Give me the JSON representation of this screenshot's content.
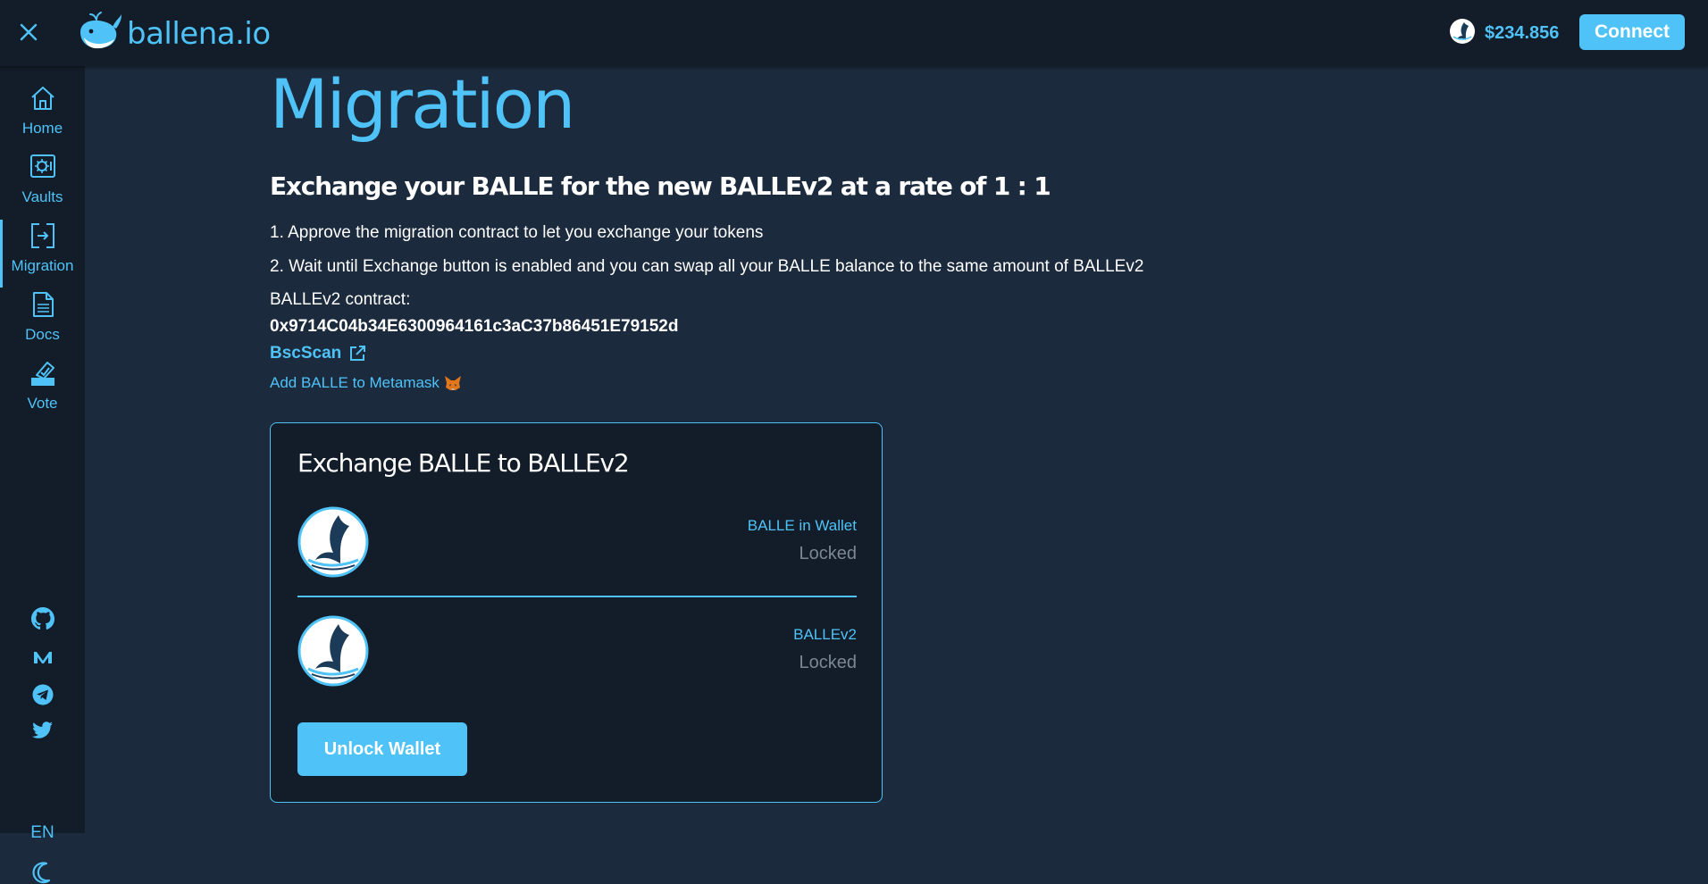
{
  "header": {
    "logo_text": "ballena.io",
    "price": "$234.856",
    "connect_label": "Connect"
  },
  "sidebar": {
    "items": [
      {
        "label": "Home",
        "icon": "home-icon"
      },
      {
        "label": "Vaults",
        "icon": "vault-icon"
      },
      {
        "label": "Migration",
        "icon": "migration-icon",
        "active": true
      },
      {
        "label": "Docs",
        "icon": "docs-icon"
      },
      {
        "label": "Vote",
        "icon": "vote-icon"
      }
    ],
    "socials": [
      "github-icon",
      "medium-icon",
      "telegram-icon",
      "twitter-icon"
    ],
    "language": "EN",
    "theme_icon": "moon-icon"
  },
  "main": {
    "title": "Migration",
    "subtitle": "Exchange your BALLE for the new BALLEv2 at a rate of 1 : 1",
    "steps": [
      "1. Approve the migration contract to let you exchange your tokens",
      "2. Wait until Exchange button is enabled and you can swap all your BALLE balance to the same amount of BALLEv2"
    ],
    "contract_label": "BALLEv2 contract:",
    "contract_address": "0x9714C04b34E6300964161c3aC37b86451E79152d",
    "bscscan_label": "BscScan",
    "metamask_label": "Add BALLE to Metamask"
  },
  "exchange_card": {
    "title": "Exchange BALLE to BALLEv2",
    "from": {
      "label": "BALLE in Wallet",
      "value": "Locked"
    },
    "to": {
      "label": "BALLEv2",
      "value": "Locked"
    },
    "unlock_label": "Unlock Wallet"
  },
  "colors": {
    "accent": "#4fc3f7",
    "bg": "#1b2a3d",
    "panel": "#131c29",
    "muted": "#7b8794"
  }
}
